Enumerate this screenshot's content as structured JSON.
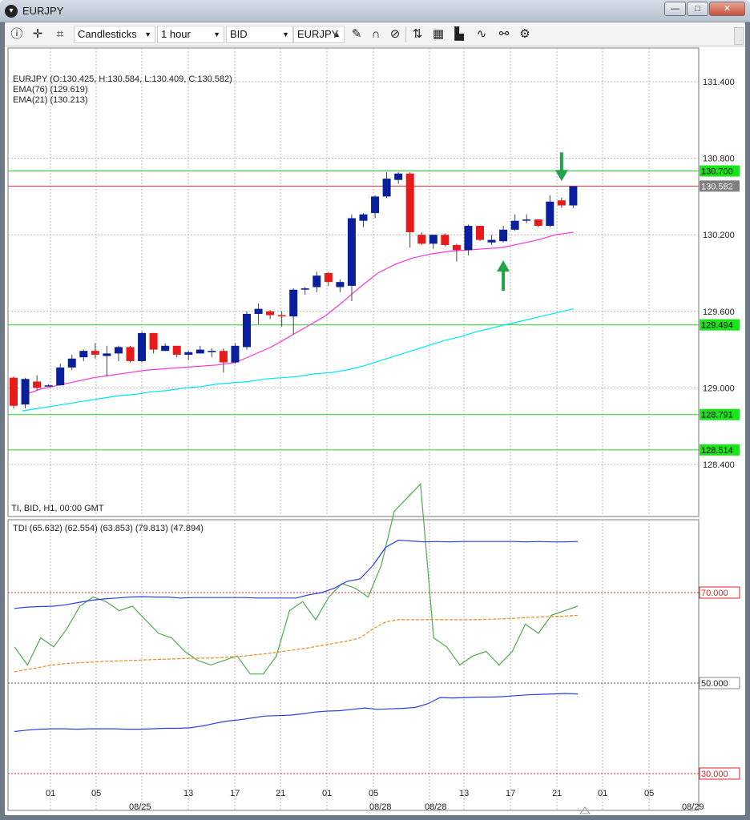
{
  "window": {
    "title": "EURJPY",
    "buttons": {
      "minimize": "—",
      "maximize": "□",
      "close": "✕"
    }
  },
  "toolbar": {
    "chart_type": "Candlesticks",
    "timeframe": "1 hour",
    "price_side": "BID",
    "symbol": "EURJPY",
    "icons": [
      "info-icon",
      "crosshair-icon",
      "crop-icon",
      "pencil-icon",
      "magnet-icon",
      "eye-off-icon",
      "sort-icon",
      "grid-icon",
      "template-icon",
      "indicator-icon",
      "link-icon",
      "settings-icon"
    ]
  },
  "colors": {
    "bull": "#0a1f9b",
    "bear": "#e81a1a",
    "ema76": "#00e5ff",
    "ema21": "#ff33dd",
    "hline_green": "#22d622",
    "hline_red": "#d32f2f",
    "tdi_green": "#4fa94f",
    "tdi_blue": "#2a3ee0",
    "tdi_orange": "#f08a1c",
    "level_red": "#e02020",
    "level_grey": "#555555"
  },
  "main_pane": {
    "overlay_lines": [
      "EURJPY (O:130.425, H:130.584, L:130.409, C:130.582)",
      "EMA(76) (129.619)",
      "EMA(21) (130.213)"
    ],
    "footer_label": "TI, BID, H1, 00:00 GMT",
    "price_axis_labels": [
      "131.400",
      "130.800",
      "130.200",
      "129.600",
      "129.000",
      "128.400"
    ],
    "hlines": [
      {
        "label": "130.700",
        "price": 130.7,
        "style": "green"
      },
      {
        "label": "130.582",
        "price": 130.582,
        "style": "current"
      },
      {
        "label": "129.494",
        "price": 129.494,
        "style": "green"
      },
      {
        "label": "128.791",
        "price": 128.791,
        "style": "green"
      },
      {
        "label": "128.514",
        "price": 128.514,
        "style": "green"
      }
    ]
  },
  "tdi_pane": {
    "title": "TDI (65.632) (62.554) (63.853) (79.813) (47.894)",
    "levels": [
      {
        "label": "70.000",
        "value": 70,
        "style": "red"
      },
      {
        "label": "50.000",
        "value": 50,
        "style": "grey"
      },
      {
        "label": "30.000",
        "value": 30,
        "style": "red"
      }
    ]
  },
  "time_axis": {
    "hour_labels": [
      "01",
      "05",
      "13",
      "17",
      "21",
      "01",
      "05",
      "13",
      "17",
      "21",
      "01",
      "05"
    ],
    "date_labels": [
      "08/25",
      "08/28",
      "08/28",
      "08/29"
    ]
  },
  "chart_data": [
    {
      "type": "candlestick",
      "title": "EURJPY H1",
      "symbol": "EURJPY",
      "timeframe": "H1",
      "ylim": [
        128.3,
        131.5
      ],
      "ohlc": [
        [
          129.08,
          129.09,
          128.84,
          128.86
        ],
        [
          128.87,
          129.08,
          128.84,
          129.07
        ],
        [
          129.05,
          129.1,
          128.98,
          129.0
        ],
        [
          129.02,
          129.03,
          129.01,
          129.02
        ],
        [
          129.02,
          129.19,
          129.02,
          129.16
        ],
        [
          129.16,
          129.26,
          129.14,
          129.23
        ],
        [
          129.24,
          129.3,
          129.21,
          129.29
        ],
        [
          129.29,
          129.35,
          129.23,
          129.26
        ],
        [
          129.25,
          129.33,
          129.09,
          129.27
        ],
        [
          129.27,
          129.33,
          129.21,
          129.32
        ],
        [
          129.32,
          129.33,
          129.2,
          129.21
        ],
        [
          129.21,
          129.44,
          129.2,
          129.43
        ],
        [
          129.43,
          129.43,
          129.27,
          129.3
        ],
        [
          129.29,
          129.35,
          129.29,
          129.33
        ],
        [
          129.33,
          129.33,
          129.24,
          129.26
        ],
        [
          129.26,
          129.29,
          129.22,
          129.28
        ],
        [
          129.27,
          129.33,
          129.27,
          129.3
        ],
        [
          129.28,
          129.31,
          129.24,
          129.29
        ],
        [
          129.29,
          129.31,
          129.12,
          129.2
        ],
        [
          129.2,
          129.35,
          129.19,
          129.33
        ],
        [
          129.32,
          129.6,
          129.3,
          129.58
        ],
        [
          129.58,
          129.66,
          129.5,
          129.62
        ],
        [
          129.6,
          129.61,
          129.54,
          129.57
        ],
        [
          129.57,
          129.6,
          129.48,
          129.56
        ],
        [
          129.56,
          129.78,
          129.42,
          129.77
        ],
        [
          129.77,
          129.79,
          129.73,
          129.78
        ],
        [
          129.79,
          129.91,
          129.75,
          129.88
        ],
        [
          129.9,
          129.91,
          129.8,
          129.83
        ],
        [
          129.79,
          129.85,
          129.75,
          129.83
        ],
        [
          129.8,
          130.36,
          129.68,
          130.33
        ],
        [
          130.31,
          130.37,
          130.26,
          130.36
        ],
        [
          130.37,
          130.51,
          130.33,
          130.5
        ],
        [
          130.5,
          130.69,
          130.49,
          130.64
        ],
        [
          130.63,
          130.69,
          130.6,
          130.68
        ],
        [
          130.68,
          130.69,
          130.1,
          130.22
        ],
        [
          130.2,
          130.22,
          130.12,
          130.13
        ],
        [
          130.13,
          130.2,
          130.09,
          130.2
        ],
        [
          130.2,
          130.21,
          130.11,
          130.12
        ],
        [
          130.12,
          130.13,
          129.99,
          130.08
        ],
        [
          130.08,
          130.28,
          130.04,
          130.27
        ],
        [
          130.27,
          130.27,
          130.15,
          130.16
        ],
        [
          130.14,
          130.2,
          130.12,
          130.16
        ],
        [
          130.15,
          130.27,
          130.14,
          130.24
        ],
        [
          130.24,
          130.36,
          130.23,
          130.31
        ],
        [
          130.31,
          130.36,
          130.29,
          130.32
        ],
        [
          130.32,
          130.32,
          130.26,
          130.27
        ],
        [
          130.27,
          130.51,
          130.26,
          130.46
        ],
        [
          130.47,
          130.49,
          130.41,
          130.43
        ],
        [
          130.43,
          130.58,
          130.41,
          130.58
        ]
      ],
      "ema76": [
        128.82,
        128.84,
        128.86,
        128.88,
        128.9,
        128.92,
        128.94,
        128.95,
        128.97,
        128.98,
        129.0,
        129.01,
        129.03,
        129.04,
        129.05,
        129.07,
        129.08,
        129.09,
        129.11,
        129.12,
        129.14,
        129.17,
        129.21,
        129.25,
        129.29,
        129.33,
        129.37,
        129.4,
        129.44,
        129.47,
        129.5,
        129.53,
        129.56,
        129.59,
        129.62
      ],
      "ema21": [
        128.94,
        128.99,
        129.02,
        129.05,
        129.08,
        129.1,
        129.12,
        129.14,
        129.15,
        129.16,
        129.17,
        129.18,
        129.2,
        129.26,
        129.32,
        129.4,
        129.48,
        129.56,
        129.67,
        129.79,
        129.9,
        129.97,
        130.02,
        130.05,
        130.07,
        130.08,
        130.09,
        130.1,
        130.13,
        130.16,
        130.2,
        130.22
      ],
      "arrows": [
        {
          "direction": "down",
          "candle_index": 47,
          "price": 130.62
        },
        {
          "direction": "up",
          "candle_index": 42,
          "price": 130.0
        }
      ]
    },
    {
      "type": "line",
      "title": "TDI",
      "ylim": [
        28,
        95
      ],
      "series": [
        {
          "name": "rsi_price_line",
          "values": [
            58,
            54,
            60,
            58,
            62,
            67,
            69,
            68,
            66,
            67,
            64,
            61,
            60,
            57,
            55,
            54,
            55,
            56,
            52,
            52,
            56,
            66,
            68,
            64,
            69,
            72,
            71,
            69,
            76,
            88,
            91,
            94,
            60,
            58,
            54,
            56,
            57,
            54,
            57,
            63,
            61,
            65,
            66,
            67
          ]
        },
        {
          "name": "upper_band",
          "values": [
            66.5,
            66.8,
            66.9,
            67.0,
            67.3,
            67.8,
            68.3,
            68.6,
            68.8,
            69.0,
            69.1,
            69.0,
            69.0,
            68.8,
            68.9,
            68.9,
            68.9,
            68.9,
            68.9,
            68.8,
            68.8,
            68.8,
            68.8,
            69.5,
            70.0,
            71.0,
            72.5,
            73.0,
            76.0,
            80.0,
            81.6,
            81.4,
            81.2,
            81.3,
            81.2,
            81.3,
            81.3,
            81.3,
            81.3,
            81.3,
            81.2,
            81.3,
            81.2,
            81.2,
            81.3
          ]
        },
        {
          "name": "market_base_line",
          "values": [
            52.5,
            53.0,
            53.5,
            54.0,
            54.3,
            54.5,
            54.6,
            54.8,
            54.9,
            55.0,
            55.1,
            55.2,
            55.3,
            55.4,
            55.5,
            55.5,
            55.6,
            55.8,
            56.0,
            56.3,
            56.6,
            57.0,
            57.4,
            57.8,
            58.3,
            58.8,
            59.3,
            60.0,
            62.0,
            63.5,
            64.0,
            64.0,
            64.0,
            64.0,
            64.0,
            64.0,
            64.0,
            64.1,
            64.2,
            64.3,
            64.5,
            64.6,
            64.7,
            64.8,
            65.0
          ]
        },
        {
          "name": "lower_band",
          "values": [
            39.3,
            39.6,
            39.8,
            39.9,
            39.9,
            39.8,
            39.9,
            39.9,
            39.9,
            39.8,
            39.8,
            39.9,
            40.0,
            40.0,
            40.1,
            40.5,
            41.1,
            41.6,
            41.9,
            42.3,
            42.7,
            42.8,
            42.9,
            43.2,
            43.6,
            43.8,
            43.9,
            44.2,
            44.5,
            44.2,
            44.3,
            44.4,
            44.6,
            45.4,
            46.8,
            46.7,
            46.8,
            46.9,
            46.9,
            47.0,
            47.2,
            47.4,
            47.5,
            47.6,
            47.7,
            47.6
          ]
        }
      ]
    }
  ]
}
